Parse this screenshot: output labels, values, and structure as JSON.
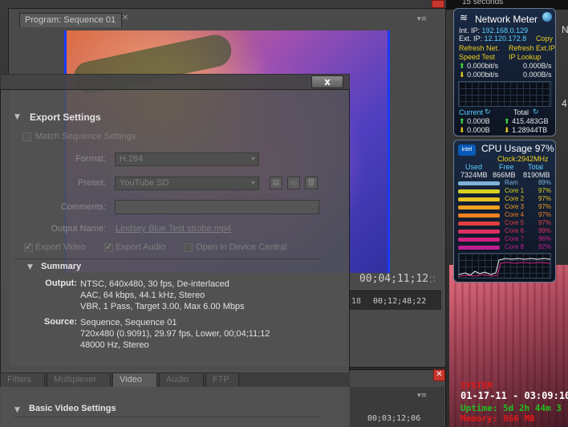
{
  "top_strip": {
    "label": "15 seconds"
  },
  "program_monitor": {
    "tab_title": "Program: Sequence 01",
    "timecode": "00;04;11;12",
    "ruler_left": "18",
    "ruler_time": "00;12;48;22"
  },
  "lower_panel": {
    "timecode": "00;03;12;06"
  },
  "export": {
    "close_label": "x",
    "section_title": "Export Settings",
    "match_sequence_label": "Match Sequence Settings",
    "format_label": "Format:",
    "format_value": "H.264",
    "preset_label": "Preset:",
    "preset_value": "YouTube SD",
    "comments_label": "Comments:",
    "output_name_label": "Output Name:",
    "output_name_value": "Lindsey Blue Test strobe.mp4",
    "export_video_label": "Export Video",
    "export_audio_label": "Export Audio",
    "open_device_central_label": "Open in Device Central",
    "summary_title": "Summary",
    "output_label": "Output:",
    "output_lines": [
      "NTSC, 640x480, 30 fps, De-interlaced",
      "AAC, 64 kbps, 44.1 kHz, Stereo",
      "VBR, 1 Pass, Target 3.00, Max 6.00 Mbps"
    ],
    "source_label": "Source:",
    "source_lines": [
      "Sequence, Sequence 01",
      "720x480 (0.9091), 29.97 fps, Lower, 00;04;11;12",
      "48000 Hz, Stereo"
    ],
    "tabs": [
      "Filters",
      "Multiplexer",
      "Video",
      "Audio",
      "FTP"
    ],
    "active_tab": "Video",
    "basic_video_title": "Basic Video Settings"
  },
  "network_meter": {
    "title": "Network Meter",
    "int_ip_label": "Int. IP:",
    "int_ip": "192.168.0.129",
    "ext_ip_label": "Ext. IP:",
    "ext_ip": "12.120.172.8",
    "copy_label": "Copy",
    "refresh_net": "Refresh Net.",
    "refresh_ext": "Refresh Ext.IP",
    "speed_test": "Speed Test",
    "ip_lookup": "IP Lookup",
    "up_bits": "0.000bit/s",
    "up_bytes": "0.000B/s",
    "down_bits": "0.000bit/s",
    "down_bytes": "0.000B/s",
    "current_label": "Current",
    "total_label": "Total",
    "current_up": "0.000B",
    "current_down": "0.000B",
    "total_up": "415.483GB",
    "total_down": "1.28944TB"
  },
  "cpu": {
    "logo": "intel",
    "title": "CPU Usage",
    "usage": "97%",
    "clock": "Clock:2942MHz",
    "used_label": "Used",
    "free_label": "Free",
    "total_label": "Total",
    "used": "7324MB",
    "free": "866MB",
    "total": "8190MB",
    "rows": [
      {
        "name": "Ram",
        "value": "89%",
        "color": "#7fb2d8"
      },
      {
        "name": "Core 1",
        "value": "97%",
        "color": "#d8d020"
      },
      {
        "name": "Core 2",
        "value": "97%",
        "color": "#e8c020"
      },
      {
        "name": "Core 3",
        "value": "97%",
        "color": "#f0a020"
      },
      {
        "name": "Core 4",
        "value": "97%",
        "color": "#f08020"
      },
      {
        "name": "Core 5",
        "value": "97%",
        "color": "#e04040"
      },
      {
        "name": "Core 6",
        "value": "99%",
        "color": "#e03060"
      },
      {
        "name": "Core 7",
        "value": "96%",
        "color": "#d02080"
      },
      {
        "name": "Core 8",
        "value": "92%",
        "color": "#c02090"
      }
    ]
  },
  "system": {
    "title": "SYSTEM",
    "datetime": "01-17-11 - 03:09:10",
    "uptime": "Uptime: 5d 2h 44m 3",
    "memory": "Memory: 866 MB"
  },
  "side_letters": {
    "n": "N",
    "four": "4"
  }
}
